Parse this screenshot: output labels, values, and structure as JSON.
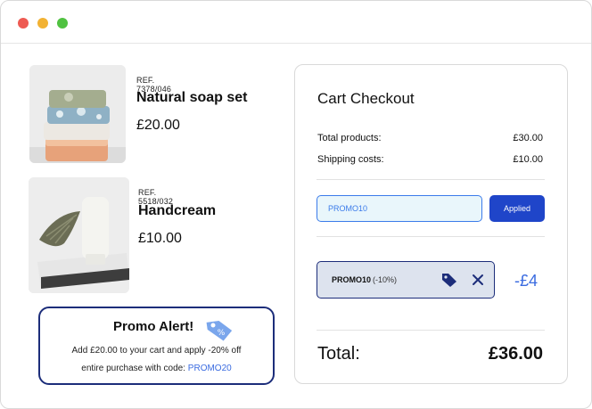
{
  "window": {
    "controls": [
      "close",
      "minimize",
      "maximize"
    ]
  },
  "products": [
    {
      "ref": "REF. 7378/046",
      "name": "Natural soap set",
      "price": "£20.00",
      "image": "soap-stack-photo"
    },
    {
      "ref": "REF. 5518/032",
      "name": "Handcream",
      "price": "£10.00",
      "image": "handcream-tube-photo"
    }
  ],
  "promo_alert": {
    "title": "Promo Alert!",
    "line1": "Add £20.00 to your cart and apply -20% off",
    "line2_prefix": "entire purchase with code: ",
    "code": "PROMO20",
    "icon": "tag-icon"
  },
  "checkout": {
    "title": "Cart Checkout",
    "total_products_label": "Total products:",
    "total_products_value": "£30.00",
    "shipping_label": "Shipping costs:",
    "shipping_value": "£10.00",
    "promo_input_value": "PROMO10",
    "applied_label": "Applied",
    "applied_chip": {
      "code": "PROMO10",
      "percent": "(-10%)"
    },
    "discount": "-£4",
    "total_label": "Total:",
    "total_value": "£36.00"
  },
  "colors": {
    "accent": "#1f45c9",
    "link": "#3a6be0",
    "border_dark": "#1c2d7a",
    "input_bg": "#e9f6fb",
    "chip_bg": "#dde3ee"
  }
}
